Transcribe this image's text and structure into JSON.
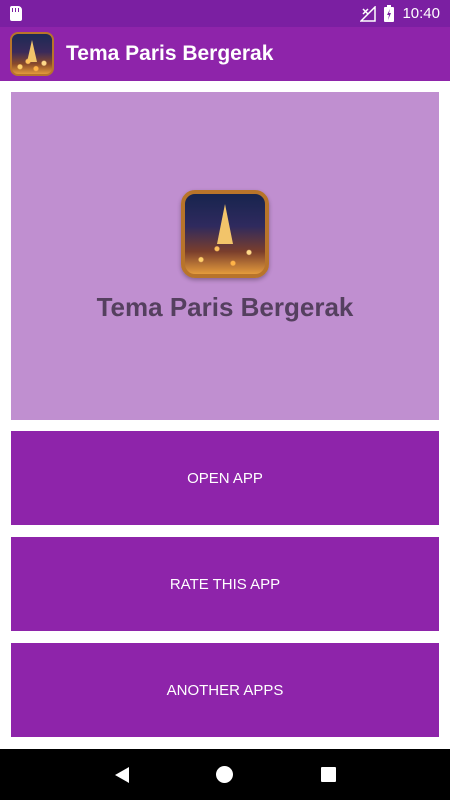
{
  "status_bar": {
    "time": "10:40",
    "icons": [
      "sd-card-icon",
      "signal-icon",
      "battery-icon"
    ]
  },
  "app_bar": {
    "title": "Tema Paris Bergerak",
    "icon": "app-icon"
  },
  "hero": {
    "title": "Tema Paris Bergerak",
    "icon": "app-icon"
  },
  "buttons": {
    "open_app": "OPEN APP",
    "rate_app": "RATE THIS APP",
    "another_apps": "ANOTHER APPS"
  },
  "nav_bar": {
    "icons": [
      "back-icon",
      "home-icon",
      "recents-icon"
    ]
  },
  "colors": {
    "primary": "#8e24aa",
    "status_bar": "#7b1fa2",
    "hero_bg": "#c08fd0",
    "hero_text": "#55405f"
  }
}
